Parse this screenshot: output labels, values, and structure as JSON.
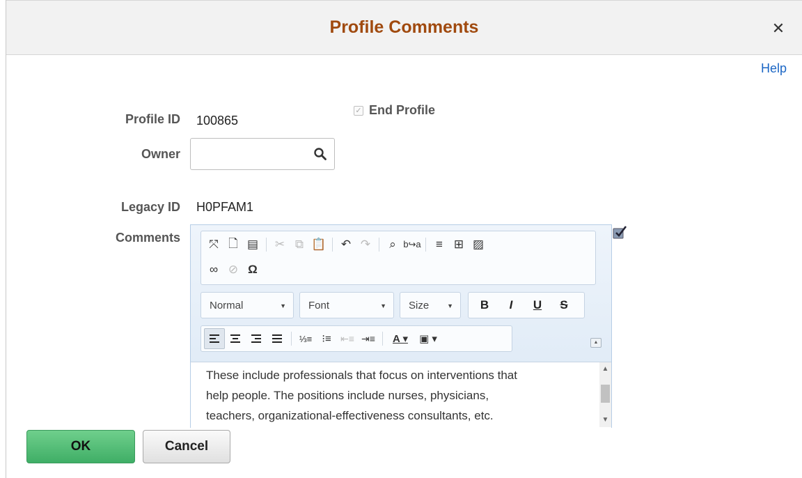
{
  "dialog": {
    "title": "Profile Comments",
    "help_label": "Help"
  },
  "form": {
    "profile_id_label": "Profile ID",
    "profile_id_value": "100865",
    "end_profile_label": "End Profile",
    "end_profile_checked": true,
    "owner_label": "Owner",
    "owner_value": "",
    "legacy_id_label": "Legacy ID",
    "legacy_id_value": "H0PFAM1",
    "comments_label": "Comments"
  },
  "editor": {
    "format_combo": "Normal",
    "font_combo": "Font",
    "size_combo": "Size",
    "bold_label": "B",
    "italic_label": "I",
    "underline_label": "U",
    "strike_label": "S",
    "text_line1": "These include professionals that focus on interventions that",
    "text_line2": "help people. The positions include nurses, physicians,",
    "text_line3": "teachers, organizational-effectiveness consultants, etc."
  },
  "buttons": {
    "ok_label": "OK",
    "cancel_label": "Cancel"
  },
  "colors": {
    "title": "#a04a0f",
    "help_link": "#1b66c5",
    "ok_button": "#4cbb73"
  },
  "icons": [
    "close-icon",
    "search-icon",
    "spellcheck-icon",
    "maximize-icon",
    "preview-icon",
    "print-icon",
    "cut-icon",
    "copy-icon",
    "paste-icon",
    "undo-icon",
    "redo-icon",
    "find-icon",
    "replace-icon",
    "horizontal-rule-icon",
    "table-icon",
    "image-icon",
    "link-icon",
    "unlink-icon",
    "special-char-icon",
    "align-left-icon",
    "align-center-icon",
    "align-right-icon",
    "justify-icon",
    "numbered-list-icon",
    "bulleted-list-icon",
    "decrease-indent-icon",
    "increase-indent-icon",
    "text-color-icon",
    "bg-color-icon"
  ]
}
